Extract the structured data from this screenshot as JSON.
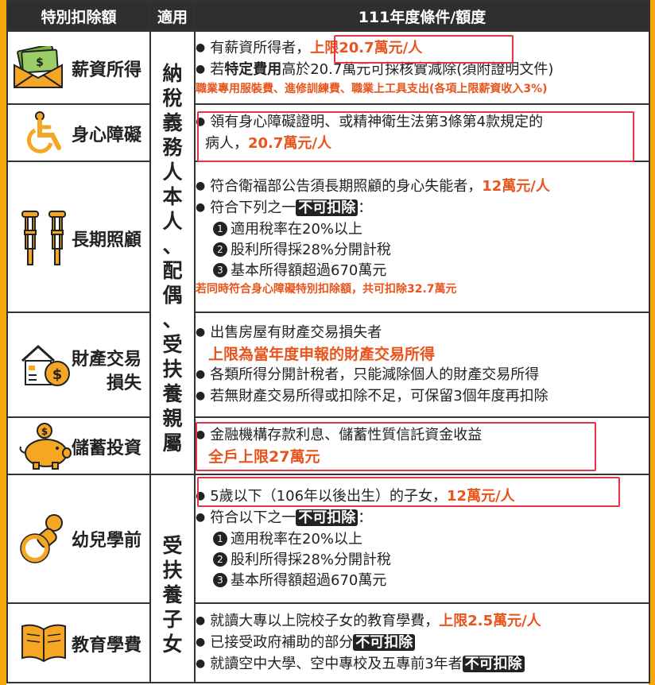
{
  "header": {
    "col1": "特別扣除額",
    "col2": "適用",
    "col3": "111年度條件/額度"
  },
  "applies": {
    "group1": [
      "納",
      "稅",
      "義",
      "務",
      "人",
      "本",
      "人",
      "、",
      "配",
      "偶",
      "、",
      "受",
      "扶",
      "養",
      "親",
      "屬"
    ],
    "group2": [
      "受",
      "扶",
      "養",
      "子",
      "女"
    ]
  },
  "rows": {
    "salary": {
      "label": "薪資所得",
      "icon": "money-envelope-icon",
      "l1a": "有薪資所得者，",
      "l1b": "上限20.7萬元/人",
      "l2a": "若",
      "l2b": "特定費用",
      "l2c": "高於20.7萬元可採核實減除(須附證明文件)",
      "note": "職業專用服裝費、進修訓練費、職業上工具支出(各項上限薪資收入3%)"
    },
    "disability": {
      "label": "身心障礙",
      "icon": "wheelchair-icon",
      "l1": "領有身心障礙證明、或精神衛生法第3條第4款規定的",
      "l2a": "病人，",
      "l2b": "20.7萬元/人"
    },
    "longterm": {
      "label": "長期照顧",
      "icon": "crutches-icon",
      "l1a": "符合衛福部公告須長期照顧的身心失能者，",
      "l1b": "12萬元/人",
      "l2a": "符合下列之一",
      "l2b": "不可扣除",
      "l2c": "：",
      "items": [
        "適用稅率在20%以上",
        "股利所得採28%分開計稅",
        "基本所得額超過670萬元"
      ],
      "nums": [
        "1",
        "2",
        "3"
      ],
      "note": "若同時符合身心障礙特別扣除額，共可扣除32.7萬元"
    },
    "property": {
      "label1": "財產交易",
      "label2": "損失",
      "icon": "house-coin-icon",
      "l1": "出售房屋有財產交易損失者",
      "l1r": "上限為當年度申報的財產交易所得",
      "l2": "各類所得分開計稅者，只能減除個人的財產交易所得",
      "l3": "若無財產交易所得或扣除不足，可保留3個年度再扣除"
    },
    "savings": {
      "label": "儲蓄投資",
      "icon": "piggy-bank-icon",
      "l1": "金融機構存款利息、儲蓄性質信託資金收益",
      "l2": "全戶上限27萬元"
    },
    "preschool": {
      "label": "幼兒學前",
      "icon": "pacifier-icon",
      "l1a": "5歲以下（106年以後出生）的子女，",
      "l1b": "12萬元/人",
      "l2a": "符合以下之一",
      "l2b": "不可扣除",
      "l2c": "：",
      "items": [
        "適用稅率在20%以上",
        "股利所得採28%分開計稅",
        "基本所得額超過670萬元"
      ],
      "nums": [
        "1",
        "2",
        "3"
      ]
    },
    "tuition": {
      "label": "教育學費",
      "icon": "book-icon",
      "l1a": "就讀大專以上院校子女的教育學費，",
      "l1b": "上限2.5萬元/人",
      "l2a": "已接受政府補助的部分",
      "l2b": "不可扣除",
      "l3a": "就讀空中大學、空中專校及五專前3年者",
      "l3b": "不可扣除"
    }
  },
  "colors": {
    "accent": "#e8541b",
    "highlight_box": "#e83347",
    "frame": "#f6a80f",
    "header_bg": "#2f2f2f"
  }
}
